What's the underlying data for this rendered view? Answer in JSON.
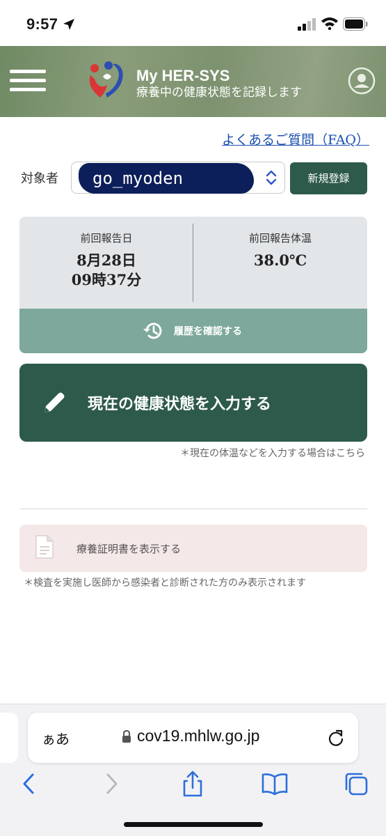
{
  "status_bar": {
    "time": "9:57"
  },
  "header": {
    "app_title": "My HER-SYS",
    "app_subtitle": "療養中の健康状態を記録します"
  },
  "faq": {
    "label": "よくあるご質問（FAQ）"
  },
  "subject": {
    "label": "対象者",
    "value": "go_myoden",
    "register_label": "新規登録"
  },
  "report": {
    "date_label": "前回報告日",
    "date_value_line1": "8月28日",
    "date_value_line2": "09時37分",
    "temp_label": "前回報告体温",
    "temp_value": "38.0℃",
    "history_label": "履歴を確認する"
  },
  "input": {
    "label": "現在の健康状態を入力する",
    "note": "＊現在の体温などを入力する場合はこちら"
  },
  "certificate": {
    "label": "療養証明書を表示する",
    "note": "＊検査を実施し医師から感染者と診断された方のみ表示されます"
  },
  "browser": {
    "aa_label": "ぁあ",
    "url": "cov19.mhlw.go.jp"
  },
  "colors": {
    "primary_dark": "#2d5a4b",
    "history_green": "#7da89b",
    "faq_blue": "#1a4fb0",
    "cert_pink": "#f5e8e8",
    "ios_blue": "#2b6fdc"
  },
  "icons": {
    "menu": "hamburger-menu-icon",
    "avatar": "user-avatar-icon",
    "history": "history-clock-icon",
    "pencil": "pencil-icon",
    "document": "document-icon",
    "lock": "lock-icon",
    "reload": "reload-icon"
  }
}
